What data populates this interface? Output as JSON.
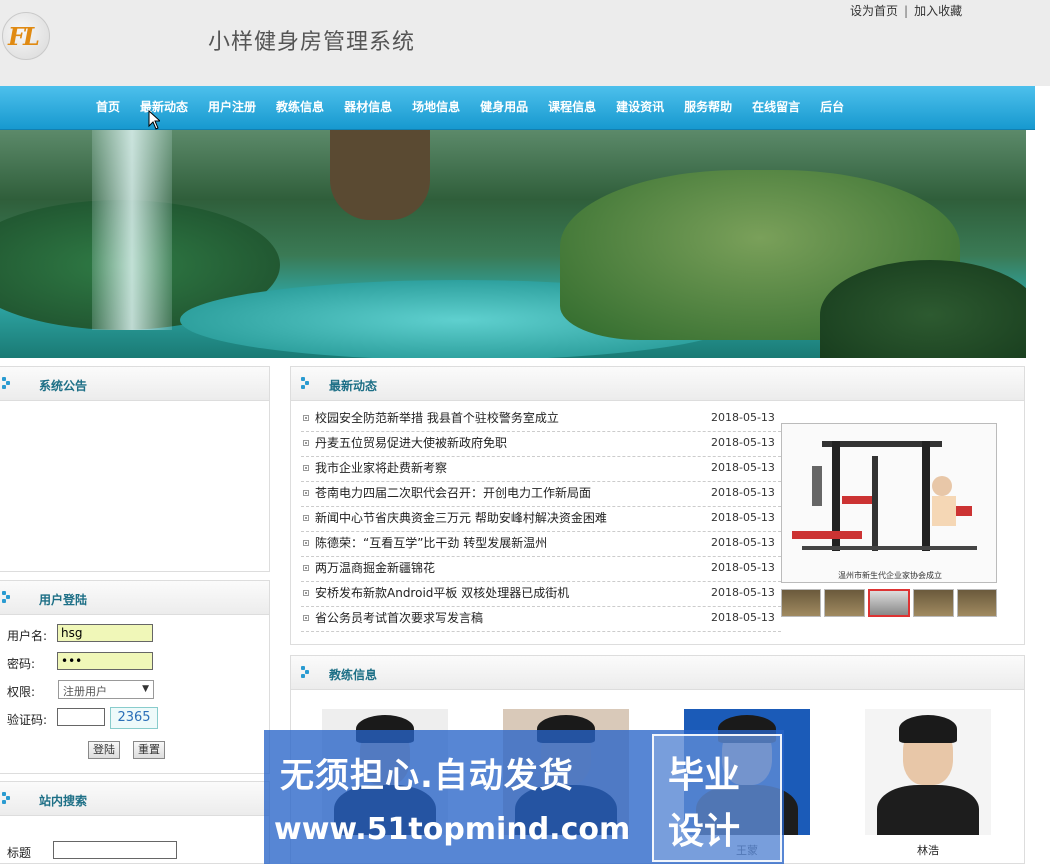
{
  "site": {
    "title": "小样健身房管理系统",
    "logo_text": "FL",
    "toplinks": [
      "设为首页",
      "加入收藏"
    ],
    "toplink_separator": "|"
  },
  "nav": [
    "首页",
    "最新动态",
    "用户注册",
    "教练信息",
    "器材信息",
    "场地信息",
    "健身用品",
    "课程信息",
    "建设资讯",
    "服务帮助",
    "在线留言",
    "后台"
  ],
  "sidebar": {
    "notice": {
      "title": "系统公告"
    },
    "login": {
      "title": "用户登陆",
      "username_label": "用户名:",
      "username_value": "hsg",
      "password_label": "密码:",
      "password_value": "•••",
      "role_label": "权限:",
      "role_value": "注册用户",
      "captcha_label": "验证码:",
      "captcha_value": "",
      "captcha_image": "2365",
      "login_button": "登陆",
      "reset_button": "重置"
    },
    "search": {
      "title": "站内搜索",
      "field_label": "标题"
    }
  },
  "news": {
    "title": "最新动态",
    "items": [
      {
        "title": "校园安全防范新举措 我县首个驻校警务室成立",
        "date": "2018-05-13"
      },
      {
        "title": "丹麦五位贸易促进大使被新政府免职",
        "date": "2018-05-13"
      },
      {
        "title": "我市企业家将赴费新考察",
        "date": "2018-05-13"
      },
      {
        "title": "苍南电力四届二次职代会召开：开创电力工作新局面",
        "date": "2018-05-13"
      },
      {
        "title": "新闻中心节省庆典资金三万元 帮助安峰村解决资金困难",
        "date": "2018-05-13"
      },
      {
        "title": "陈德荣：“互看互学”比干劲 转型发展新温州",
        "date": "2018-05-13"
      },
      {
        "title": "两万温商掘金新疆锦花",
        "date": "2018-05-13"
      },
      {
        "title": "安桥发布新款Android平板 双核处理器已成街机",
        "date": "2018-05-13"
      },
      {
        "title": "省公务员考试首次要求写发言稿",
        "date": "2018-05-13"
      }
    ],
    "photo_caption": "温州市新生代企业家协会成立"
  },
  "coaches": {
    "title": "教练信息",
    "items": [
      {
        "name": ""
      },
      {
        "name": ""
      },
      {
        "name": "王蒙"
      },
      {
        "name": "林浩"
      }
    ]
  },
  "watermark": {
    "line1": "无须担心.自动发货",
    "line2": "www.51topmind.com",
    "badge_line1": "毕业",
    "badge_line2": "设计"
  },
  "colors": {
    "nav_bg": "#1799cf",
    "title_accent": "#1d6f86",
    "input_highlight": "#f0f7b8"
  }
}
